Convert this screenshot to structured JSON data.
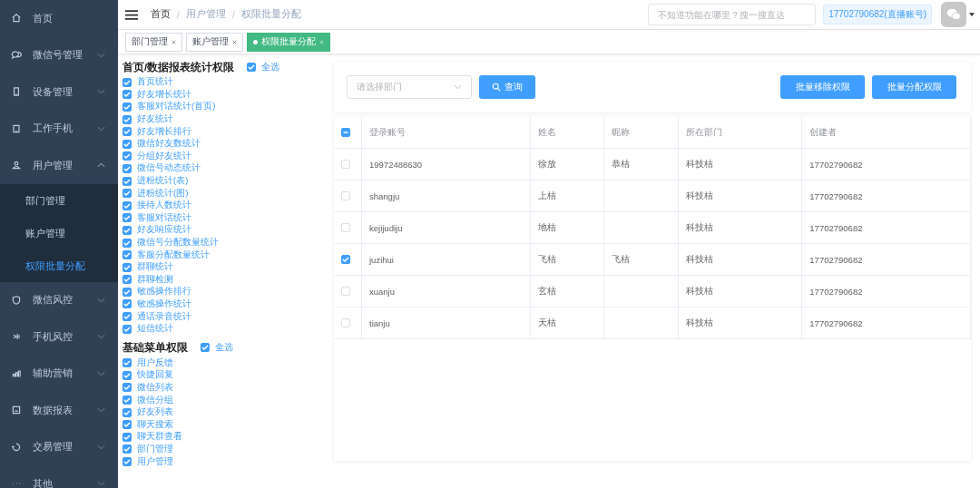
{
  "sidebar": {
    "items": [
      {
        "label": "首页",
        "kind": "link"
      },
      {
        "label": "微信号管理",
        "kind": "group",
        "expanded": false
      },
      {
        "label": "设备管理",
        "kind": "group",
        "expanded": false
      },
      {
        "label": "工作手机",
        "kind": "group",
        "expanded": false
      },
      {
        "label": "用户管理",
        "kind": "group",
        "expanded": true,
        "children": [
          {
            "label": "部门管理",
            "selected": false
          },
          {
            "label": "账户管理",
            "selected": false
          },
          {
            "label": "权限批量分配",
            "selected": true
          }
        ]
      },
      {
        "label": "微信风控",
        "kind": "group",
        "expanded": false
      },
      {
        "label": "手机风控",
        "kind": "group",
        "expanded": false
      },
      {
        "label": "辅助营销",
        "kind": "group",
        "expanded": false
      },
      {
        "label": "数据报表",
        "kind": "group",
        "expanded": false
      },
      {
        "label": "交易管理",
        "kind": "group",
        "expanded": false
      },
      {
        "label": "其他",
        "kind": "group",
        "expanded": false
      }
    ]
  },
  "breadcrumb": [
    {
      "label": "首页"
    },
    {
      "separator": "/",
      "label": "用户管理"
    },
    {
      "separator": "/",
      "label": "权限批量分配"
    }
  ],
  "search": {
    "placeholder": "不知道功能在哪里？搜一搜直达"
  },
  "account_tag": "17702790682(直播账号)",
  "tabs": [
    {
      "label": "部门管理",
      "selected": false
    },
    {
      "label": "账户管理",
      "selected": false
    },
    {
      "label": "权限批量分配",
      "selected": true
    }
  ],
  "permission_groups": [
    {
      "title": "首页/数据报表统计权限",
      "select_all": {
        "label": "全选",
        "checked": true
      },
      "items": [
        {
          "label": "首页统计",
          "checked": true
        },
        {
          "label": "好友增长统计",
          "checked": true
        },
        {
          "label": "客服对话统计(首页)",
          "checked": true
        },
        {
          "label": "好友统计",
          "checked": true
        },
        {
          "label": "好友增长排行",
          "checked": true
        },
        {
          "label": "微信好友数统计",
          "checked": true
        },
        {
          "label": "分组好友统计",
          "checked": true
        },
        {
          "label": "微信号动态统计",
          "checked": true
        },
        {
          "label": "进粉统计(表)",
          "checked": true
        },
        {
          "label": "进粉统计(图)",
          "checked": true
        },
        {
          "label": "接待人数统计",
          "checked": true
        },
        {
          "label": "客服对话统计",
          "checked": true
        },
        {
          "label": "好友响应统计",
          "checked": true
        },
        {
          "label": "微信号分配数量统计",
          "checked": true
        },
        {
          "label": "客服分配数量统计",
          "checked": true
        },
        {
          "label": "群聊统计",
          "checked": true
        },
        {
          "label": "群聊检测",
          "checked": true
        },
        {
          "label": "敏感操作排行",
          "checked": true
        },
        {
          "label": "敏感操作统计",
          "checked": true
        },
        {
          "label": "通话录音统计",
          "checked": true
        },
        {
          "label": "短信统计",
          "checked": true
        }
      ]
    },
    {
      "title": "基础菜单权限",
      "select_all": {
        "label": "全选",
        "checked": true
      },
      "items": [
        {
          "label": "用户反馈",
          "checked": true
        },
        {
          "label": "快捷回复",
          "checked": true
        },
        {
          "label": "微信列表",
          "checked": true
        },
        {
          "label": "微信分组",
          "checked": true
        },
        {
          "label": "好友列表",
          "checked": true
        },
        {
          "label": "聊天搜索",
          "checked": true
        },
        {
          "label": "聊天群查看",
          "checked": true
        },
        {
          "label": "部门管理",
          "checked": true
        },
        {
          "label": "用户管理",
          "checked": true
        }
      ]
    }
  ],
  "filter": {
    "placeholder": "请选择部门",
    "query_button": "查询"
  },
  "actions": [
    "批量移除权限",
    "批量分配权限"
  ],
  "table": {
    "header_checkbox": {
      "indeterminate": true
    },
    "columns": [
      "登录账号",
      "姓名",
      "昵称",
      "所在部门",
      "创建者"
    ],
    "rows": [
      {
        "selected": false,
        "cells": [
          "19972488630",
          "徐放",
          "恭桔",
          "科技桔",
          "17702790682"
        ]
      },
      {
        "selected": false,
        "cells": [
          "shangju",
          "上桔",
          "",
          "科技桔",
          "17702790682"
        ]
      },
      {
        "selected": false,
        "cells": [
          "kejijudiju",
          "地桔",
          "",
          "科技桔",
          "17702790682"
        ]
      },
      {
        "selected": true,
        "cells": [
          "juzihui",
          "飞桔",
          "飞桔",
          "科技桔",
          "17702790682"
        ]
      },
      {
        "selected": false,
        "cells": [
          "xuanju",
          "玄桔",
          "",
          "科技桔",
          "17702790682"
        ]
      },
      {
        "selected": false,
        "cells": [
          "tianju",
          "天桔",
          "",
          "科技桔",
          "17702790682"
        ]
      }
    ]
  }
}
